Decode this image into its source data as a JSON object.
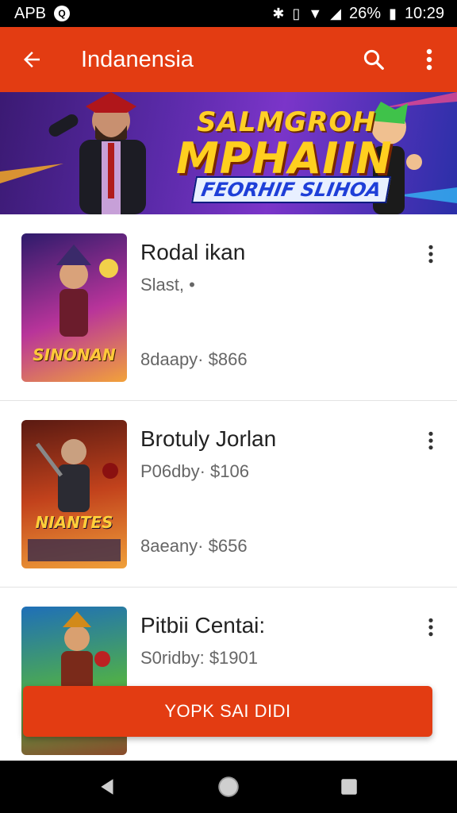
{
  "status_bar": {
    "carrier": "APB",
    "notification_badge": "Q",
    "battery": "26%",
    "time": "10:29",
    "icons": [
      "bluetooth-icon",
      "vibrate-icon",
      "wifi-icon",
      "signal-icon",
      "battery-icon"
    ]
  },
  "toolbar": {
    "title": "Indanensia",
    "icons": [
      "back-arrow-icon",
      "search-icon",
      "more-vert-icon"
    ]
  },
  "banner": {
    "line1": "SALMGROH",
    "line2": "MPHAIIN",
    "line3": "FEORHIF SLIHOA"
  },
  "items": [
    {
      "name": "Rodal ikan",
      "subtitle": "Slast, •",
      "price": "8daapy· $866",
      "thumb_caption": "SINONAN",
      "thumb_colors": [
        "#2d1b6b",
        "#b8349a",
        "#f2a23a"
      ]
    },
    {
      "name": "Brotuly Jorlan",
      "subtitle": "P06dby· $106",
      "price": "8aeany· $656",
      "thumb_caption": "NIANTES",
      "thumb_colors": [
        "#5a1a12",
        "#c2421c",
        "#f0a03a"
      ]
    },
    {
      "name": "Pitbii Centai:",
      "subtitle": "S0ridby: $1901",
      "price": "",
      "thumb_caption": "",
      "thumb_colors": [
        "#1f6fb8",
        "#4fae4a",
        "#8a4a2a"
      ]
    }
  ],
  "action_button": {
    "label": "YOPK SAI DIDI"
  },
  "nav_bar": {
    "icons": [
      "nav-back-icon",
      "nav-home-icon",
      "nav-recents-icon"
    ]
  },
  "colors": {
    "accent": "#e33c12",
    "text_primary": "#222222",
    "text_secondary": "#666666"
  }
}
